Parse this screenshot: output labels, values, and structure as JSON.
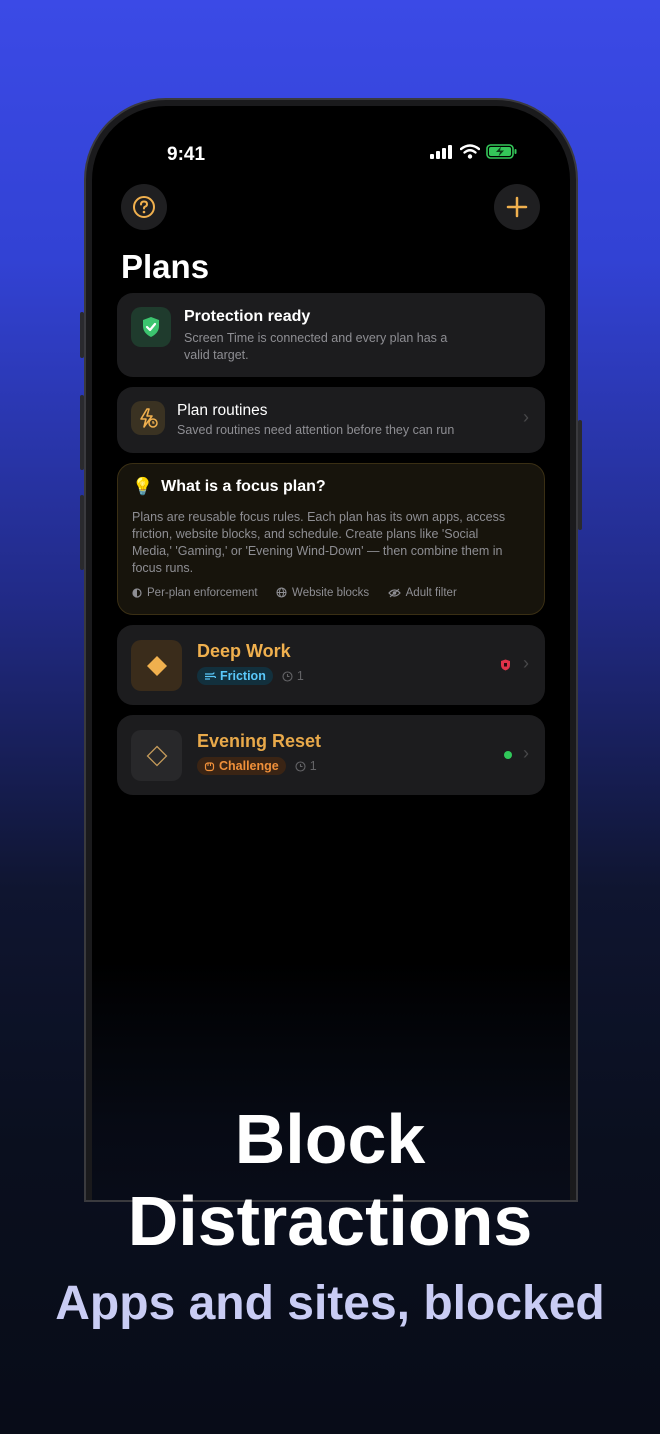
{
  "status_bar": {
    "time": "9:41"
  },
  "header": {
    "title": "Plans",
    "help_icon": "question-circle-icon",
    "add_icon": "plus-icon"
  },
  "protection_card": {
    "title": "Protection ready",
    "subtitle_line1": "Screen Time is connected and every plan has a",
    "subtitle_line2": "valid target.",
    "icon": "shield-check-icon"
  },
  "routines_card": {
    "title": "Plan routines",
    "subtitle": "Saved routines need attention before they can run",
    "icon": "bolt-clock-icon"
  },
  "info_card": {
    "emoji": "💡",
    "title": "What is a focus plan?",
    "body_lines": [
      "Plans are reusable focus rules. Each plan has its own apps, access",
      "friction, website blocks, and schedule. Create plans like 'Social",
      "Media,' 'Gaming,' or 'Evening Wind-Down' — then combine them in",
      "focus runs."
    ],
    "features": [
      "Per-plan enforcement",
      "Website blocks",
      "Adult filter"
    ]
  },
  "plans": [
    {
      "name": "Deep Work",
      "mode": "Friction",
      "runs": "1",
      "status": "shield-alert",
      "status_color": "#e0334a",
      "accent": "#e8a94a"
    },
    {
      "name": "Evening Reset",
      "mode": "Challenge",
      "runs": "1",
      "status": "active-dot",
      "status_color": "#30c85a",
      "accent": "#e8a94a"
    }
  ],
  "marketing": {
    "headline_line1": "Block",
    "headline_line2": "Distractions",
    "subheadline": "Apps and sites, blocked"
  },
  "colors": {
    "accent": "#f0b04e",
    "friction": "#5ac8fa",
    "challenge": "#f0903a"
  }
}
